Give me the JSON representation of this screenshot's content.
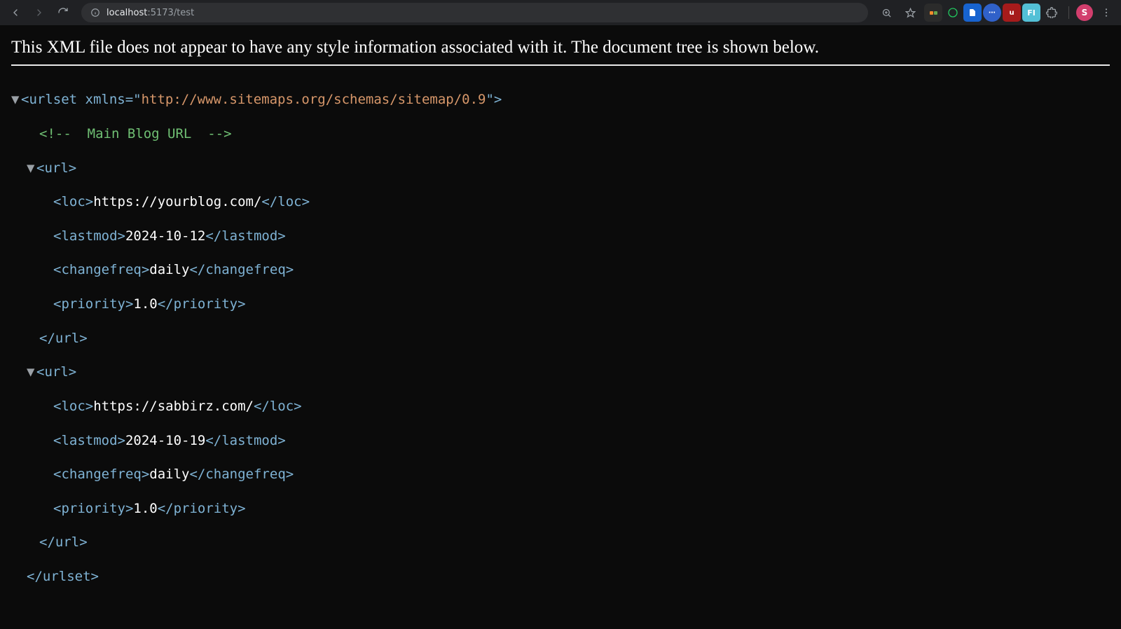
{
  "browser": {
    "url_host": "localhost",
    "url_rest": ":5173/test",
    "profile_initial": "S"
  },
  "xml_viewer": {
    "notice": "This XML file does not appear to have any style information associated with it. The document tree is shown below.",
    "root": {
      "open_prefix": "<urlset xmlns=\"",
      "xmlns": "http://www.sitemaps.org/schemas/sitemap/0.9",
      "open_suffix": "\">",
      "close": "</urlset>"
    },
    "comment": "<!--  Main Blog URL  -->",
    "urls": [
      {
        "url_open": "<url>",
        "loc_open": "<loc>",
        "loc": "https://yourblog.com/",
        "loc_close": "</loc>",
        "lastmod_open": "<lastmod>",
        "lastmod": "2024-10-12",
        "lastmod_close": "</lastmod>",
        "changefreq_open": "<changefreq>",
        "changefreq": "daily",
        "changefreq_close": "</changefreq>",
        "priority_open": "<priority>",
        "priority": "1.0",
        "priority_close": "</priority>",
        "url_close": "</url>"
      },
      {
        "url_open": "<url>",
        "loc_open": "<loc>",
        "loc": "https://sabbirz.com/",
        "loc_close": "</loc>",
        "lastmod_open": "<lastmod>",
        "lastmod": "2024-10-19",
        "lastmod_close": "</lastmod>",
        "changefreq_open": "<changefreq>",
        "changefreq": "daily",
        "changefreq_close": "</changefreq>",
        "priority_open": "<priority>",
        "priority": "1.0",
        "priority_close": "</priority>",
        "url_close": "</url>"
      }
    ]
  }
}
